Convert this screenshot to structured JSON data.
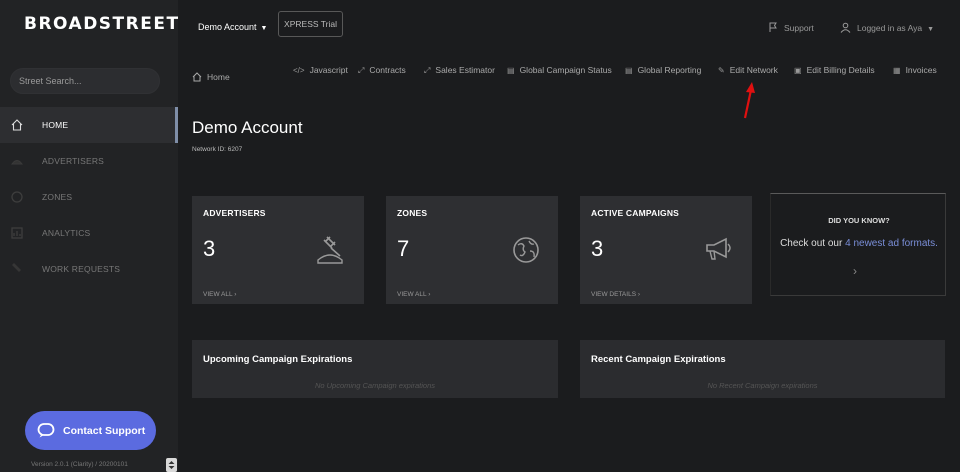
{
  "brand": {
    "logo_text": "BROADSTREET"
  },
  "search": {
    "placeholder": "Street Search..."
  },
  "sidebar": {
    "items": [
      {
        "label": "HOME",
        "icon": "home-icon"
      },
      {
        "label": "ADVERTISERS",
        "icon": "advertisers-icon"
      },
      {
        "label": "ZONES",
        "icon": "zones-icon"
      },
      {
        "label": "ANALYTICS",
        "icon": "analytics-icon"
      },
      {
        "label": "WORK REQUESTS",
        "icon": "work-requests-icon"
      }
    ]
  },
  "contact_support": {
    "label": "Contact Support"
  },
  "version": "Version 2.0.1 (Clarity) / 20200101",
  "topbar": {
    "account": "Demo Account",
    "trial": "XPRESS Trial",
    "support": "Support",
    "logged_in": "Logged in as Aya"
  },
  "breadcrumb": {
    "home": "Home"
  },
  "toolbar": {
    "javascript": "Javascript",
    "contracts": "Contracts",
    "sales_estimator": "Sales Estimator",
    "global_campaign_status": "Global Campaign Status",
    "global_reporting": "Global Reporting",
    "edit_network": "Edit Network",
    "edit_billing": "Edit Billing Details",
    "invoices": "Invoices"
  },
  "page": {
    "title": "Demo Account",
    "network_id": "Network ID: 6207"
  },
  "cards": {
    "advertisers": {
      "heading": "ADVERTISERS",
      "count": "3",
      "link": "VIEW ALL ›"
    },
    "zones": {
      "heading": "ZONES",
      "count": "7",
      "link": "VIEW ALL ›"
    },
    "campaigns": {
      "heading": "ACTIVE CAMPAIGNS",
      "count": "3",
      "link": "VIEW DETAILS ›"
    }
  },
  "did_you_know": {
    "heading": "DID YOU KNOW?",
    "text_prefix": "Check out our",
    "link": "4 newest ad formats.",
    "chevron": "›"
  },
  "panels": {
    "upcoming": {
      "heading": "Upcoming Campaign Expirations",
      "empty": "No Upcoming Campaign expirations"
    },
    "recent": {
      "heading": "Recent Campaign Expirations",
      "empty": "No Recent Campaign expirations"
    }
  },
  "colors": {
    "background": "#1b1c1e",
    "sidebar": "#222325",
    "card": "#2e2f32",
    "accent_button": "#5b6be0",
    "link": "#7a8ed8",
    "annotation_arrow": "#e01010"
  }
}
